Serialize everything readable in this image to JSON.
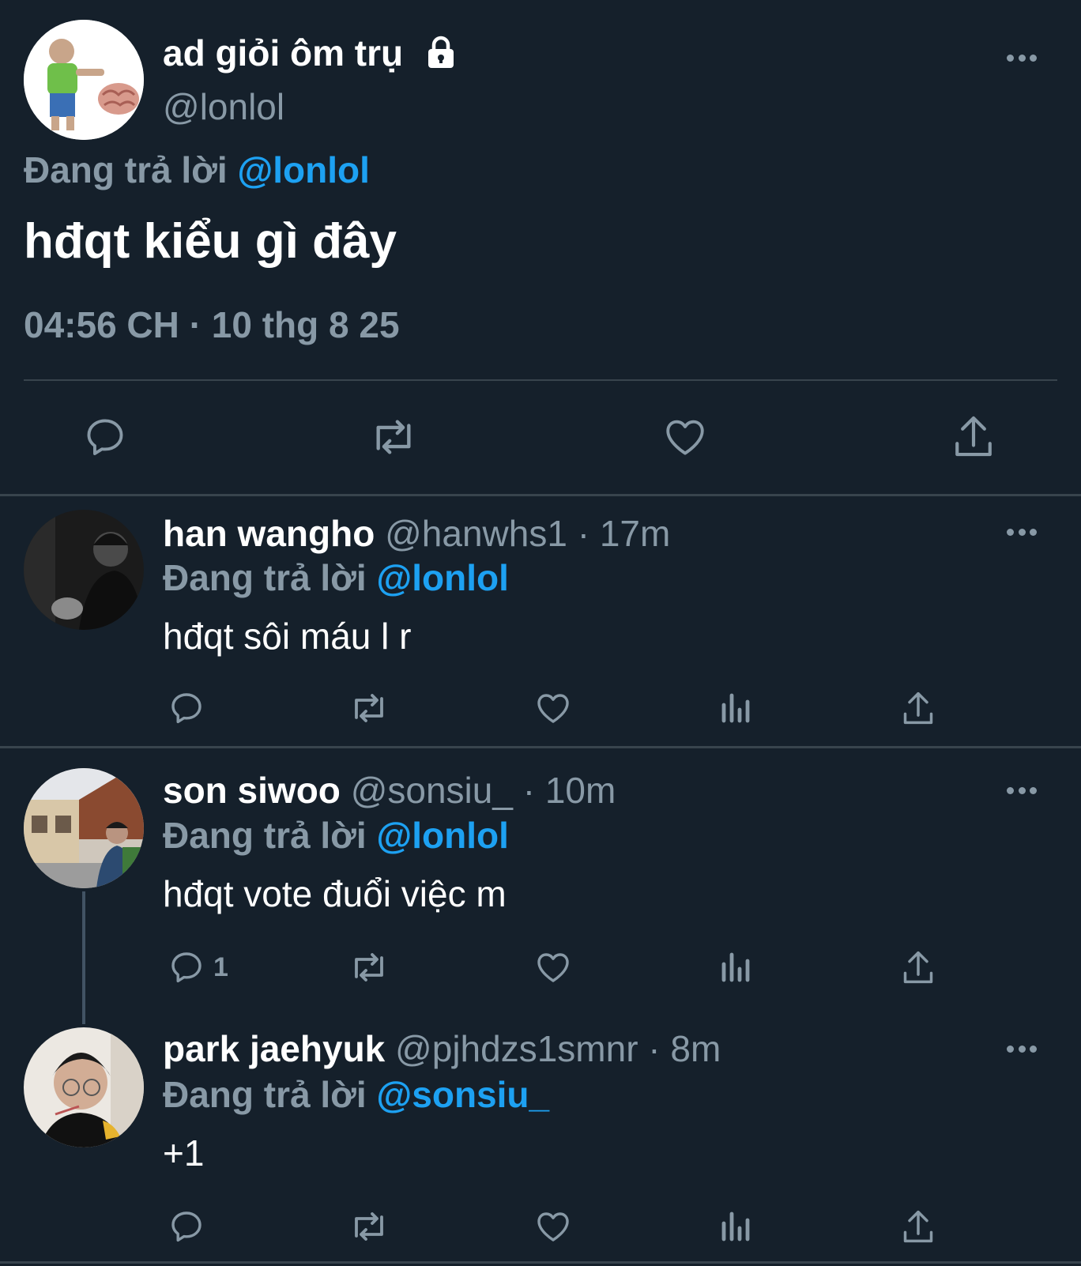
{
  "main_tweet": {
    "display_name": "ad giỏi ôm trụ",
    "handle": "@lonlol",
    "locked": "lock-icon",
    "replying_prefix": "Đang trả lời",
    "replying_to": "@lonlol",
    "text": "hđqt kiểu gì đây",
    "timestamp": "04:56 CH · 10 thg 8 25",
    "actions": [
      "reply-icon",
      "retweet-icon",
      "like-icon",
      "share-icon"
    ]
  },
  "replies": [
    {
      "display_name": "han wangho",
      "handle": "@hanwhs1",
      "time": " · 17m",
      "replying_prefix": "Đang trả lời",
      "replying_to": "@lonlol",
      "text": "hđqt sôi máu l r",
      "reply_count": ""
    },
    {
      "display_name": "son siwoo",
      "handle": "@sonsiu_",
      "time": " · 10m",
      "replying_prefix": "Đang trả lời",
      "replying_to": "@lonlol",
      "text": "hđqt vote đuổi việc m",
      "reply_count": "1"
    },
    {
      "display_name": "park jaehyuk",
      "handle": "@pjhdzs1smnr",
      "time": " · 8m",
      "replying_prefix": "Đang trả lời",
      "replying_to": "@sonsiu_",
      "text": "+1",
      "reply_count": ""
    }
  ],
  "colors": {
    "background": "#15202b",
    "text_primary": "#ffffff",
    "text_secondary": "#8899a6",
    "accent": "#1da1f2",
    "divider": "#38444d"
  }
}
